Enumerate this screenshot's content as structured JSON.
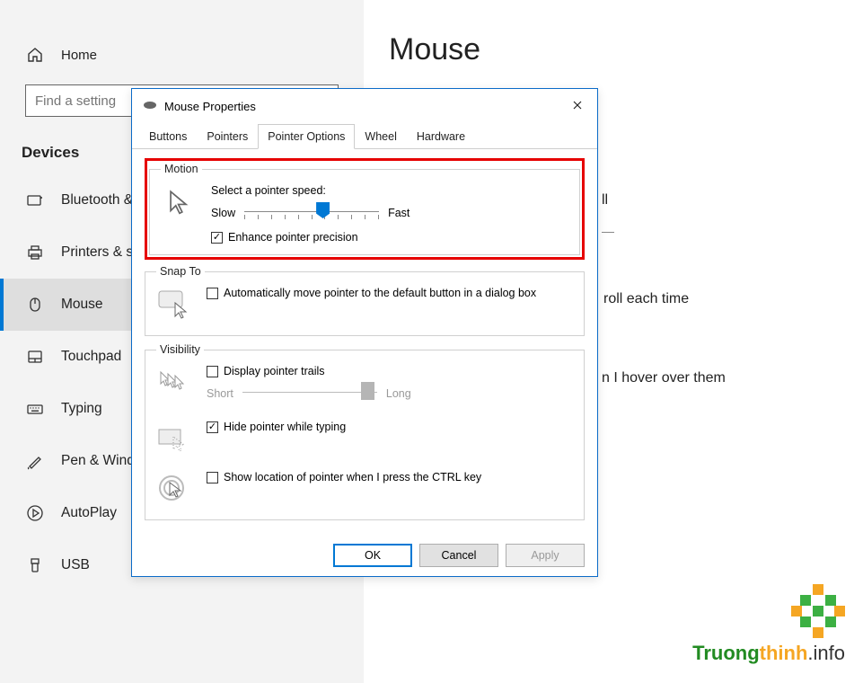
{
  "sidebar": {
    "home": "Home",
    "search_placeholder": "Find a setting",
    "group_header": "Devices",
    "items": [
      {
        "label": "Bluetooth & other devices"
      },
      {
        "label": "Printers & scanners"
      },
      {
        "label": "Mouse"
      },
      {
        "label": "Touchpad"
      },
      {
        "label": "Typing"
      },
      {
        "label": "Pen & Windows Ink"
      },
      {
        "label": "AutoPlay"
      },
      {
        "label": "USB"
      }
    ]
  },
  "main": {
    "title": "Mouse",
    "bg_line1_suffix": "ll",
    "bg_line2": "roll each time",
    "bg_line3": "n I hover over them"
  },
  "dialog": {
    "title": "Mouse Properties",
    "tabs": [
      "Buttons",
      "Pointers",
      "Pointer Options",
      "Wheel",
      "Hardware"
    ],
    "motion": {
      "legend": "Motion",
      "label": "Select a pointer speed:",
      "slow": "Slow",
      "fast": "Fast",
      "enhance": "Enhance pointer precision"
    },
    "snapto": {
      "legend": "Snap To",
      "label": "Automatically move pointer to the default button in a dialog box"
    },
    "visibility": {
      "legend": "Visibility",
      "trails": "Display pointer trails",
      "short": "Short",
      "long": "Long",
      "hide": "Hide pointer while typing",
      "ctrl": "Show location of pointer when I press the CTRL key"
    },
    "buttons": {
      "ok": "OK",
      "cancel": "Cancel",
      "apply": "Apply"
    }
  },
  "watermark": {
    "brand1": "Truong",
    "brand2": "thinh",
    "domain": ".info"
  }
}
